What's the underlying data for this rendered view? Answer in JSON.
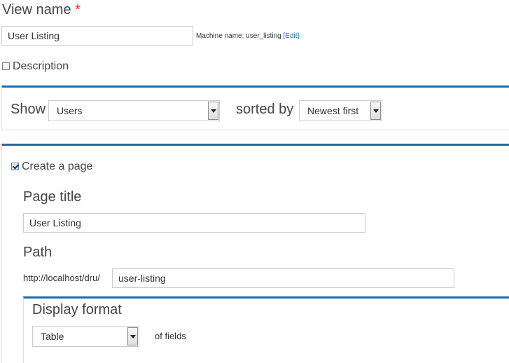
{
  "view_name": {
    "label": "View name",
    "required_mark": "*",
    "value": "User Listing",
    "machine_name_prefix": "Machine name: user_listing",
    "edit_link": "Edit"
  },
  "description": {
    "label": "Description",
    "checked": false
  },
  "show_panel": {
    "show_label": "Show",
    "show_value": "Users",
    "sorted_label": "sorted by",
    "sorted_value": "Newest first"
  },
  "page_panel": {
    "create_page_label": "Create a page",
    "create_page_checked": true,
    "page_title_label": "Page title",
    "page_title_value": "User Listing",
    "path_label": "Path",
    "path_prefix": "http://localhost/dru/",
    "path_value": "user-listing",
    "display_format": {
      "label": "Display format",
      "format_value": "Table",
      "of_label": "of fields"
    }
  },
  "colors": {
    "accent": "#1a6ca8",
    "link": "#0071b3",
    "required": "#e0301e"
  }
}
